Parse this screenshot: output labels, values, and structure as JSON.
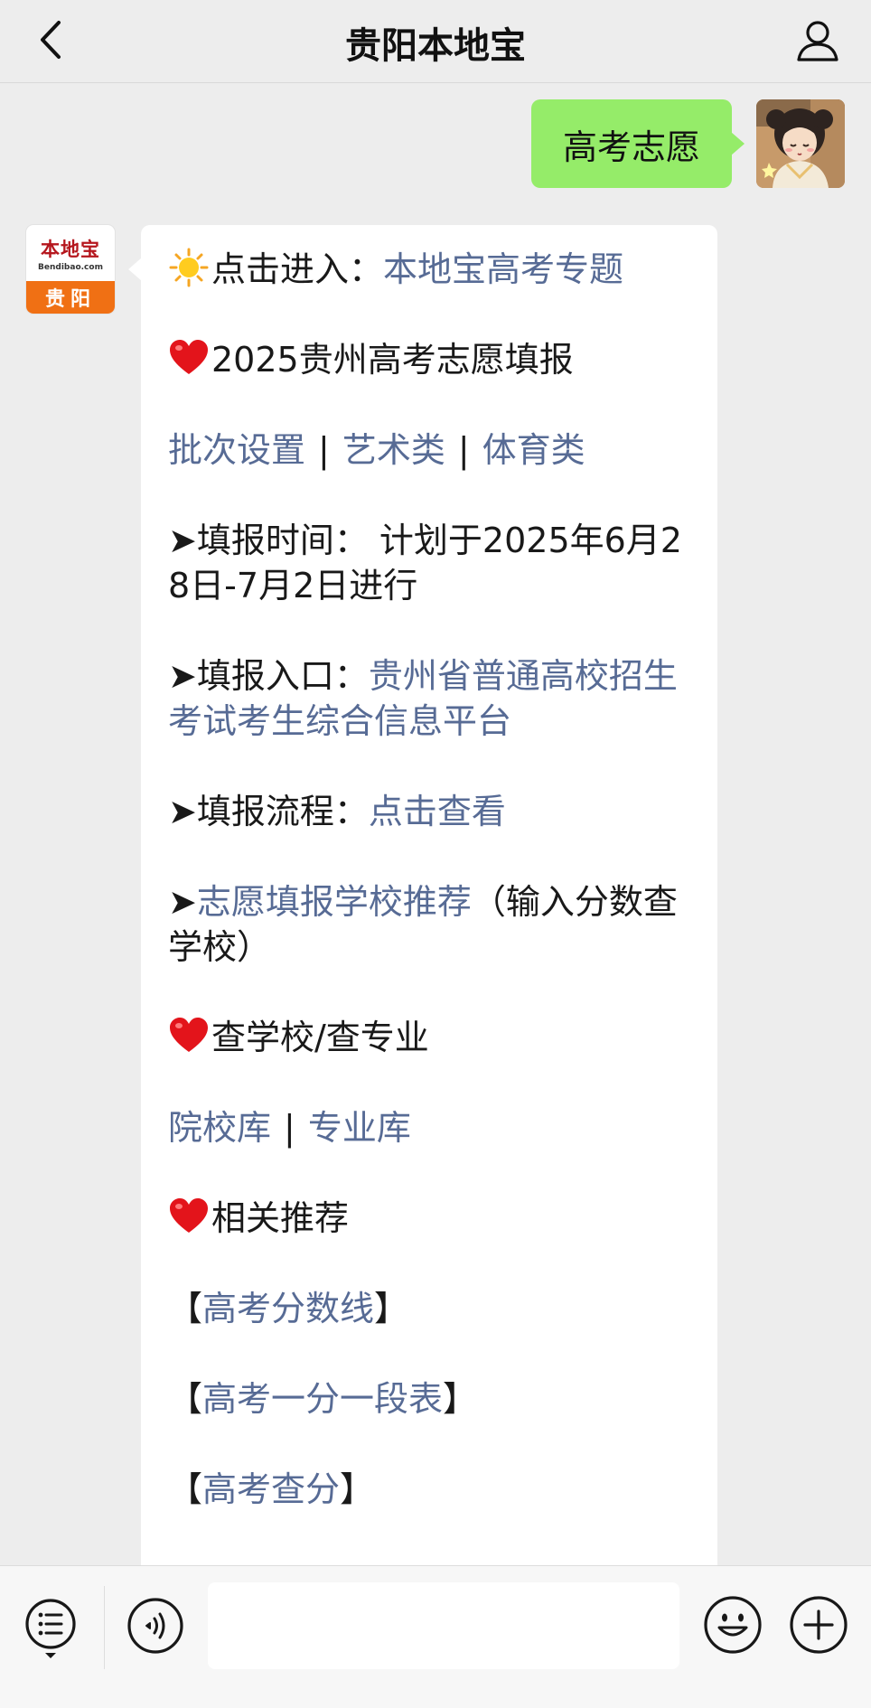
{
  "header": {
    "title": "贵阳本地宝",
    "back_icon": "chevron-left-icon",
    "profile_icon": "person-icon"
  },
  "user_message": {
    "text": "高考志愿"
  },
  "bot_avatar": {
    "brand": "本地宝",
    "site": "Bendibao.com",
    "city": "贵阳"
  },
  "bot_message": {
    "line1": {
      "prefix": "点击进入：",
      "link": "本地宝高考专题"
    },
    "line2": {
      "text": "2025贵州高考志愿填报"
    },
    "line3": {
      "links": [
        "批次设置",
        "艺术类",
        "体育类"
      ],
      "separator": "|"
    },
    "line4": {
      "text": "➤填报时间：  计划于2025年6月28日-7月2日进行"
    },
    "line5": {
      "prefix": "➤填报入口：",
      "link": "贵州省普通高校招生考试考生综合信息平台"
    },
    "line6": {
      "prefix": "➤填报流程：",
      "link": "点击查看"
    },
    "line7": {
      "prefix": "➤",
      "link": "志愿填报学校推荐",
      "suffix": "（输入分数查学校）"
    },
    "line8": {
      "text": "查学校/查专业"
    },
    "line9": {
      "links": [
        "院校库",
        "专业库"
      ],
      "separator": "|"
    },
    "line10": {
      "text": "相关推荐"
    },
    "line11": {
      "open": "【",
      "link": "高考分数线",
      "close": "】"
    },
    "line12": {
      "open": "【",
      "link": "高考一分一段表",
      "close": "】"
    },
    "line13": {
      "open": "【",
      "link": "高考查分",
      "close": "】"
    }
  },
  "input_bar": {
    "menu_icon": "list-menu-icon",
    "voice_icon": "voice-icon",
    "input_value": "",
    "emoji_icon": "smiley-icon",
    "plus_icon": "plus-icon"
  },
  "colors": {
    "background": "#ededed",
    "user_bubble": "#95ec69",
    "link": "#576b95",
    "brand_orange": "#f07014",
    "brand_red": "#b5161d"
  }
}
